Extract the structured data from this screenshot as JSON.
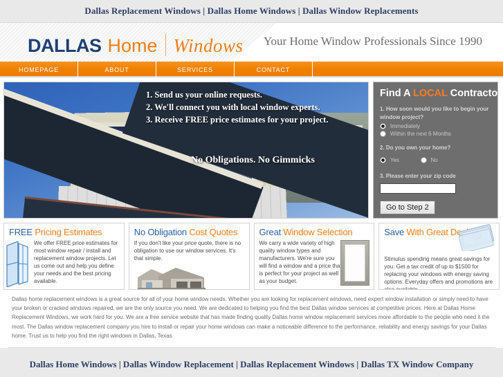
{
  "topbar": {
    "keywords": "Dallas Replacement Windows | Dallas Home Windows | Dallas Window Replacements"
  },
  "header": {
    "logo": {
      "word1": "DALLAS",
      "word2": "Home",
      "word3": "Windows"
    },
    "tagline": "Your Home Window Professionals Since 1990"
  },
  "nav": {
    "items": [
      {
        "label": "HOMEPAGE"
      },
      {
        "label": "ABOUT"
      },
      {
        "label": "SERVICES"
      },
      {
        "label": "CONTACT"
      }
    ]
  },
  "hero": {
    "steps": "1. Send us your online requests.\n2. We'll connect you with local window experts.\n3. Receive FREE price estimates for your project.",
    "subline": "No Obligations. No Gimmicks"
  },
  "form": {
    "title_pre": "Find A ",
    "title_highlight": "LOCAL",
    "title_post": " Contractor",
    "q1": "1. How soon would you like to begin your window project?",
    "q1_options": [
      {
        "label": "Immediately",
        "selected": true
      },
      {
        "label": "Within the next 6 Months",
        "selected": false
      }
    ],
    "q2": "2. Do you own your home?",
    "q2_options": [
      {
        "label": "Yes",
        "selected": true
      },
      {
        "label": "No",
        "selected": false
      }
    ],
    "q3": "3. Please enter your zip code",
    "zip_value": "",
    "zip_placeholder": "",
    "submit_label": "Go to Step 2"
  },
  "features": [
    {
      "title_pre": "FREE",
      "title_post": " Pricing Estimates",
      "body": "We offer FREE price estimates for most window repair / install and replacement window projects. Let us come out and help you define your needs and the best pricing available.",
      "icon": "open-window-icon"
    },
    {
      "title_pre": "No Obligation",
      "title_post": " Cost Quotes",
      "body": "If you don't like your price quote, there is no obligation to use our window services. It's that simple.",
      "icon": "house-icon"
    },
    {
      "title_pre": "Great",
      "title_post": " Window Selection",
      "body": "We carry a wide variety of high quality window types and manufacturers. We're sure you will find a window and a price that is perfect for your project as well as your budget.",
      "icon": "window-frame-icon"
    },
    {
      "title_pre": "Save",
      "title_post": " With Great Deals",
      "body": "Stimulus spending means great savings for you. Get a tax credit of up to $1500 for replacing your windows with energy saving options. Everyday offers and promotions are also available.",
      "icon": "money-icon"
    }
  ],
  "article": {
    "text": "Dallas home replacement windows is a great source for all of your home window needs. Whether you are looking for replacement windows, need expert window installation or simply need to have your broken or cracked windows repaired, we are the only source you need. We are dedicated to helping you find the best Dallas window services at competitive prices. Here at Dallas Home Replacement Windows, we work hard for you. We are a free service website that has made finding quality Dallas home window replacement services more affordable to the people who need it the most. The Dallas window replacement company you hire to install or repair your home windows can make a noticeable difference to the performance, reliability and energy savings for your Dallas home. Trust us to help you find the right windows in Dallas, Texas."
  },
  "footer": {
    "links": "Dallas Home Windows | Dallas Window Replacement | Dallas Replacement Windows | Dallas TX Window Company"
  },
  "colors": {
    "navy": "#2c3f63",
    "orange": "#f07d18",
    "nav_orange": "#f08000",
    "panel_gray": "#6e6e6e",
    "page_bg": "#e9e9e9",
    "title_blue": "#2a5fa8"
  }
}
